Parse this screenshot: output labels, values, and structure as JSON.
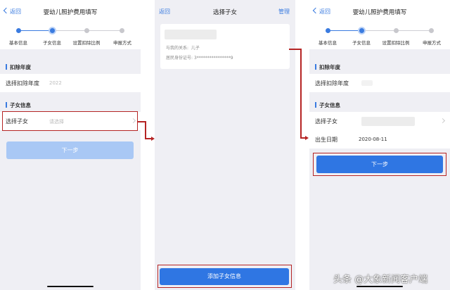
{
  "common": {
    "back": "返回",
    "steps": [
      "基本信息",
      "子女信息",
      "设置扣除比例",
      "申报方式"
    ],
    "section_year": "扣除年度",
    "section_child": "子女信息",
    "next": "下一步"
  },
  "screen1": {
    "title": "婴幼儿照护费用填写",
    "year_label": "选择扣除年度",
    "year_value": "2022",
    "child_label": "选择子女",
    "child_placeholder": "请选择"
  },
  "screen2": {
    "title": "选择子女",
    "manage": "管理",
    "relation_label": "与我的关系:",
    "relation_value": "儿子",
    "id_label": "居民身份证号:",
    "id_value": "3****************9",
    "add_button": "添加子女信息"
  },
  "screen3": {
    "title": "婴幼儿照护费用填写",
    "year_label": "选择扣除年度",
    "child_label": "选择子女",
    "birth_label": "出生日期",
    "birth_value": "2020-08-11"
  },
  "watermark": "头条 @大象新闻客户端",
  "colors": {
    "accent": "#2f76e3",
    "annotation": "#b52424",
    "disabled": "#a9c8f5"
  }
}
